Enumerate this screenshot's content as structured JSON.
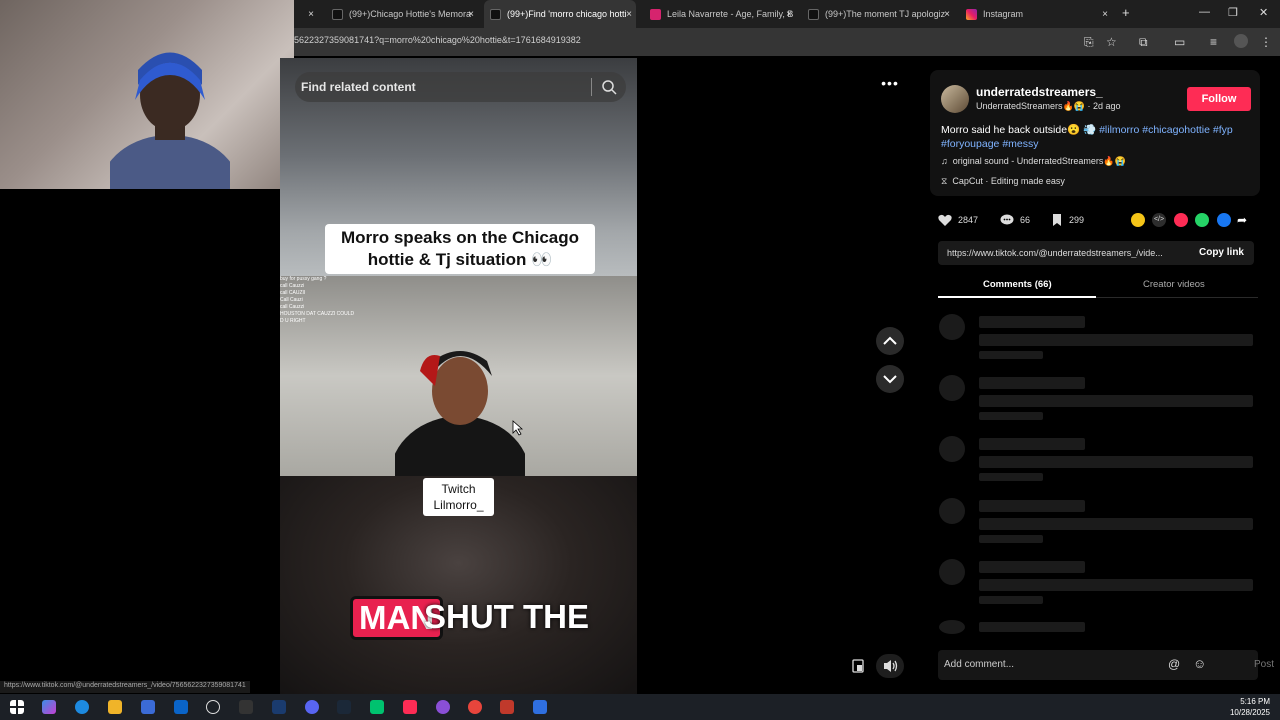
{
  "browser": {
    "tabs": [
      {
        "title": "(99+)Chicago Hottie's Memora",
        "favicon": "tiktok",
        "active": false
      },
      {
        "title": "(99+)Find 'morro chicago hotti",
        "favicon": "tiktok",
        "active": true
      },
      {
        "title": "Leila Navarrete - Age, Family, B",
        "favicon": "famous",
        "active": false
      },
      {
        "title": "(99+)The moment TJ apologiz",
        "favicon": "tiktok",
        "active": false
      },
      {
        "title": "Instagram",
        "favicon": "instagram",
        "active": false
      }
    ],
    "close_glyph": "×",
    "new_tab_glyph": "+",
    "url": "56223273590817​41?q=morro%20chicago%20hottie&t=1761684919382"
  },
  "video": {
    "search_placeholder": "Find related content",
    "caption_line1": "Morro speaks on the Chicago",
    "caption_line2": "hottie & Tj situation 👀",
    "chat_lines": [
      "buy for pussy gang ?",
      "call Cauzzi",
      "call CAUZII",
      "Call Cauzi",
      "call Cauzzi",
      "HOUSTON DAT CAUZZI COULD",
      "D U RIGHT"
    ],
    "twitch_line1": "Twitch",
    "twitch_line2": "Lilmorro_",
    "subtitle_highlight": "MAN",
    "subtitle_rest": "SHUT THE"
  },
  "post": {
    "username": "underratedstreamers_",
    "display_name": "UnderratedStreamers🔥😭",
    "time_ago": "2d ago",
    "follow_label": "Follow",
    "description_text": "Morro said he back outside😮 💨",
    "hashtags": [
      "#lilmorro",
      "#chicagohottie",
      "#fyp",
      "#foryoupage",
      "#messy"
    ],
    "sound": "original sound - UnderratedStreamers🔥😭",
    "capcut": "CapCut · Editing made easy",
    "likes": "2847",
    "comments_count": "66",
    "saves": "299",
    "link": "https://www.tiktok.com/@underratedstreamers_/vide...",
    "copy_link_label": "Copy link",
    "tab_comments": "Comments (66)",
    "tab_creator": "Creator videos",
    "add_comment_placeholder": "Add comment...",
    "post_label": "Post"
  },
  "status_url": "https://www.tiktok.com/@underratedstreamers_/video/7565622327359081741",
  "taskbar": {
    "time": "5:16 PM",
    "date": "10/28/2025"
  },
  "colors": {
    "accent": "#fe2c55",
    "hashtag": "#7fb3ff",
    "panel_bg": "#000000",
    "tab_bar": "#1f1f1f",
    "address_bar": "#353535"
  }
}
